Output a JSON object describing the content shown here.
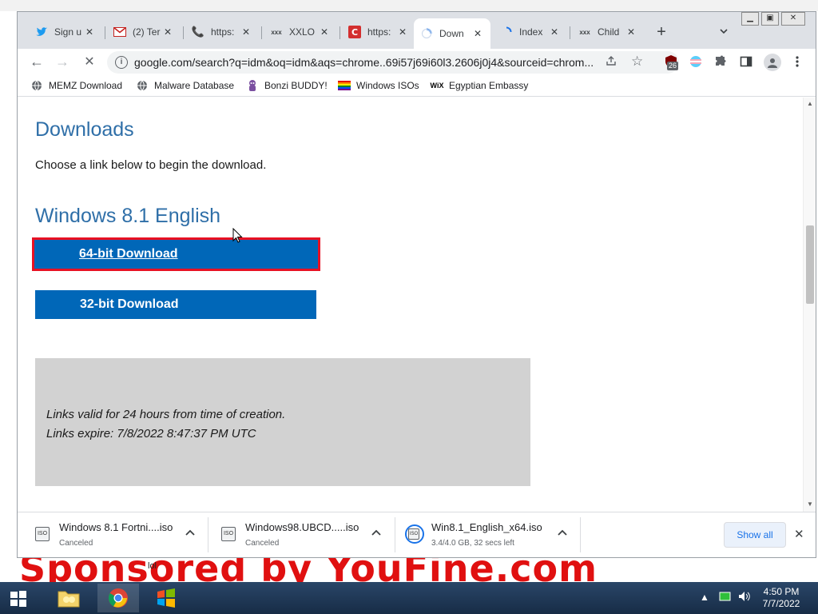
{
  "window": {
    "tabs": [
      {
        "title": "Sign u",
        "icon": "twitter-icon"
      },
      {
        "title": "(2) Ter",
        "icon": "gmail-icon"
      },
      {
        "title": "https:",
        "icon": "phone-icon"
      },
      {
        "title": "XXLO",
        "icon": "xxx-icon"
      },
      {
        "title": "https:",
        "icon": "c-icon"
      },
      {
        "title": "Down",
        "icon": "loading-spinner-icon",
        "active": true
      },
      {
        "title": "Index",
        "icon": "loading-spinner-icon"
      },
      {
        "title": "Child",
        "icon": "xxx-icon"
      }
    ],
    "new_tab": "+",
    "tab_search": "⌄",
    "controls": {
      "minimize": "▁",
      "maximize": "▣",
      "close": "✕"
    }
  },
  "toolbar": {
    "back": "←",
    "forward": "→",
    "reload": "✕",
    "url": "google.com/search?q=idm&oq=idm&aqs=chrome..69i57j69i60l3.2606j0j4&sourceid=chrom...",
    "extension_badge": "26"
  },
  "bookmarks": [
    {
      "label": "MEMZ Download",
      "icon": "globe-icon"
    },
    {
      "label": "Malware Database",
      "icon": "globe-icon"
    },
    {
      "label": "Bonzi BUDDY!",
      "icon": "bonzi-icon"
    },
    {
      "label": "Windows ISOs",
      "icon": "rainbow-flag-icon"
    },
    {
      "label": "Egyptian Embassy",
      "icon": "wix-icon"
    }
  ],
  "page": {
    "heading": "Downloads",
    "intro": "Choose a link below to begin the download.",
    "product_heading": "Windows 8.1 English",
    "btn_64": "64-bit Download",
    "btn_32": "32-bit Download",
    "notice_line1": "Links valid for 24 hours from time of creation.",
    "notice_line2": "Links expire: 7/8/2022 8:47:37 PM UTC"
  },
  "downloads": [
    {
      "name": "Windows 8.1 Fortni....iso",
      "status": "Canceled"
    },
    {
      "name": "Windows98.UBCD.....iso",
      "status": "Canceled"
    },
    {
      "name": "Win8.1_English_x64.iso",
      "status": "3.4/4.0 GB, 32 secs left",
      "progress": 0.85
    }
  ],
  "shelf": {
    "show_all": "Show all",
    "close": "✕"
  },
  "taskbar": {
    "time": "4:50 PM",
    "date": "7/7/2022"
  },
  "desktop": {
    "watermark": "Sponsored by YouFine.com",
    "icon_label": "lol"
  },
  "colors": {
    "link_heading": "#2f6fa8",
    "button": "#0067b8",
    "focus_outline": "#e81123",
    "watermark": "#e01010"
  }
}
